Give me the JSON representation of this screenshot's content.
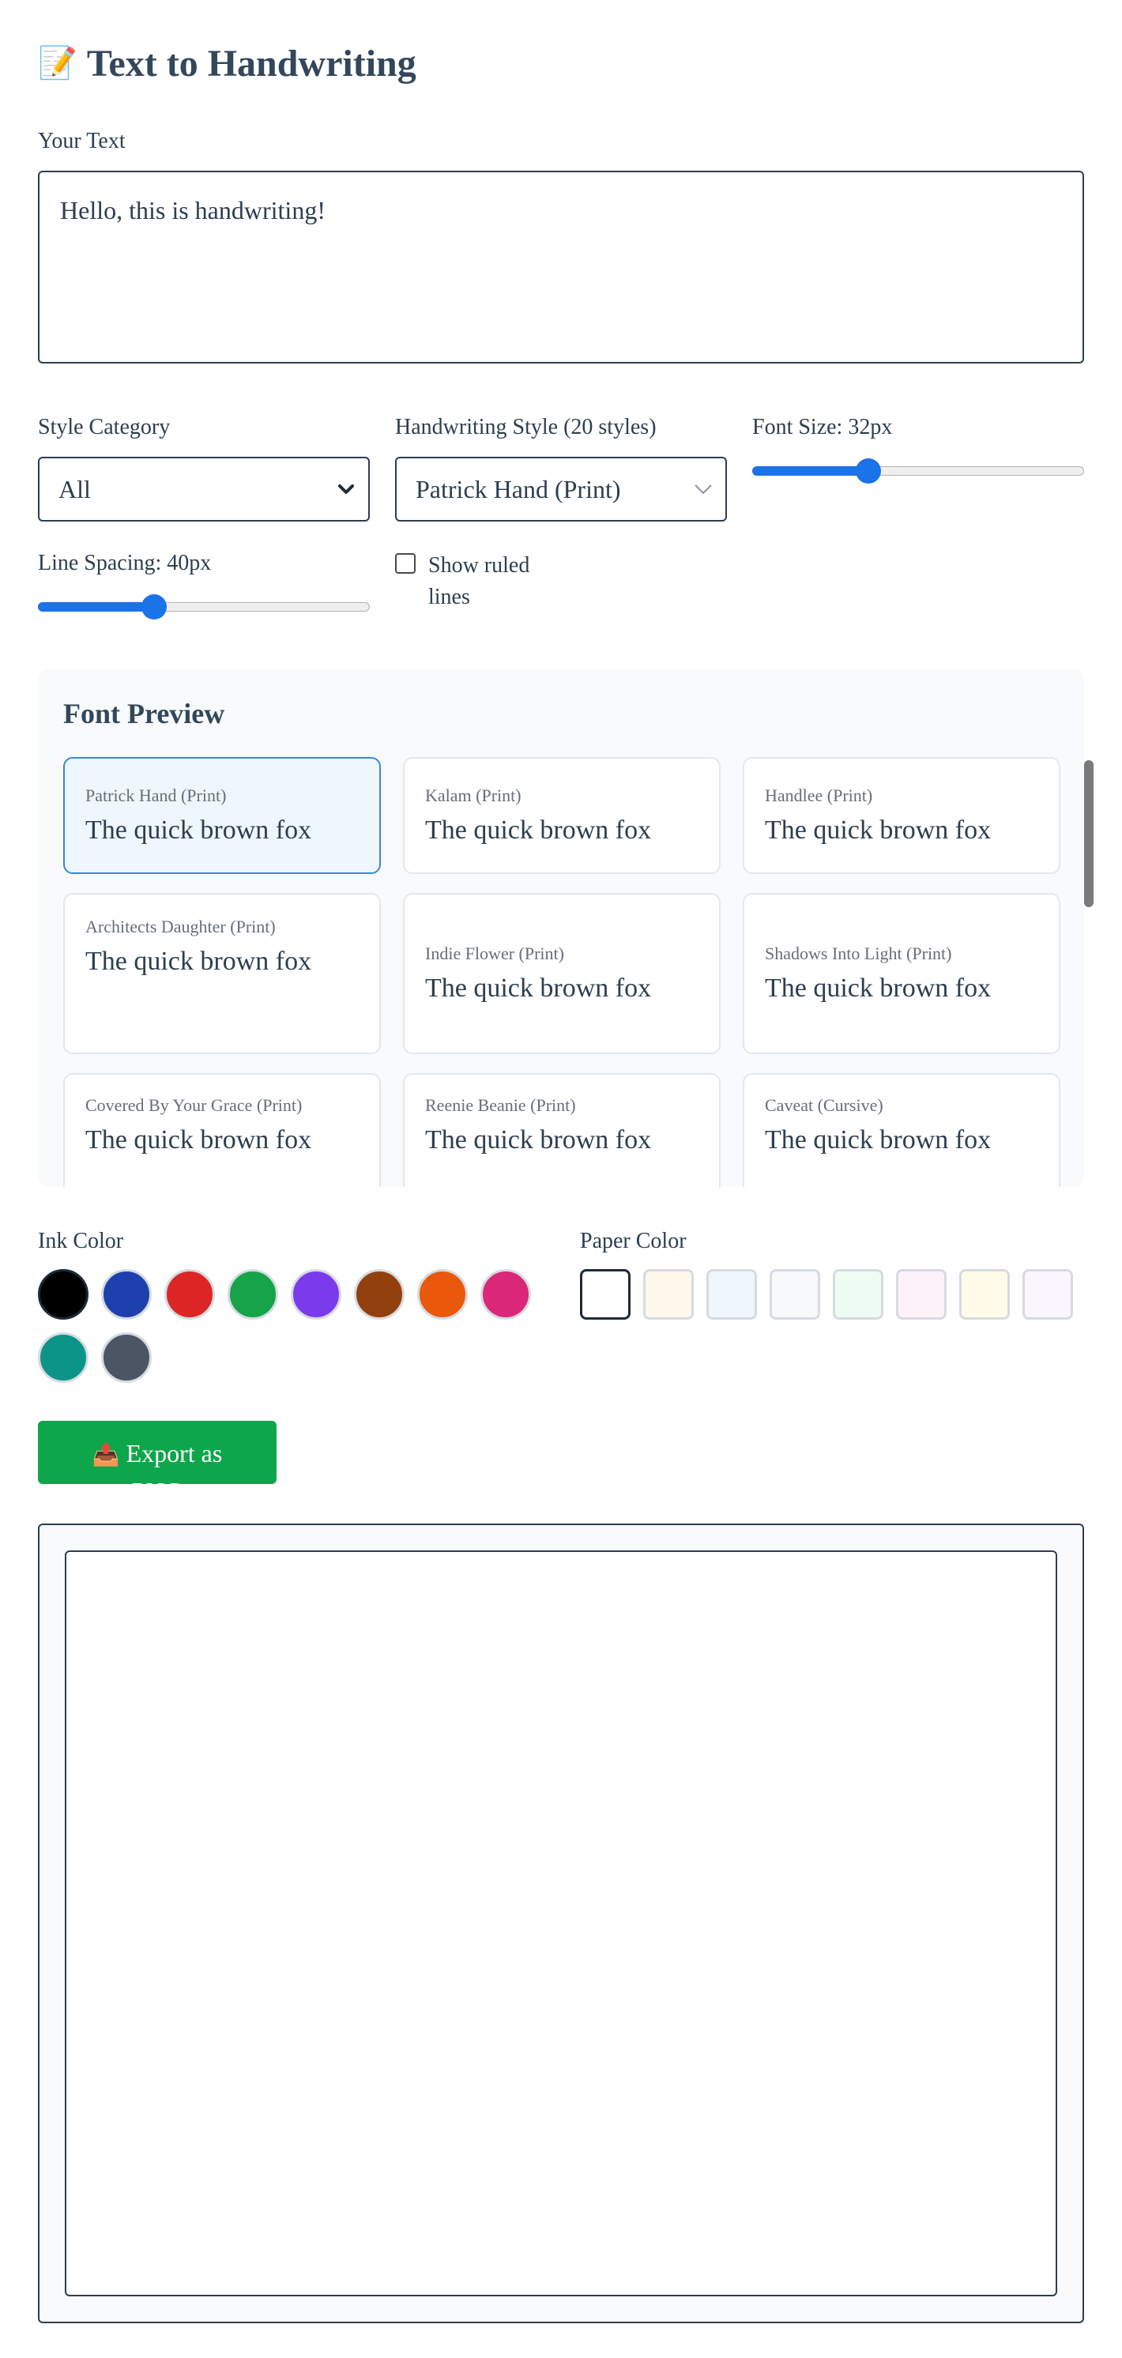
{
  "header": {
    "emoji": "📝",
    "title": "Text to Handwriting"
  },
  "text_input": {
    "label": "Your Text",
    "value": "Hello, this is handwriting!"
  },
  "style_category": {
    "label": "Style Category",
    "selected": "All"
  },
  "handwriting_style": {
    "label": "Handwriting Style (20 styles)",
    "selected": "Patrick Hand (Print)"
  },
  "font_size": {
    "label": "Font Size: 32px",
    "fraction": 0.35
  },
  "line_spacing": {
    "label": "Line Spacing: 40px",
    "fraction": 0.35
  },
  "ruled_lines": {
    "label": "Show ruled lines",
    "checked": false
  },
  "preview": {
    "title": "Font Preview",
    "cards": [
      {
        "name": "Patrick Hand (Print)",
        "sample": "The quick brown fox",
        "selected": true
      },
      {
        "name": "Kalam (Print)",
        "sample": "The quick brown fox"
      },
      {
        "name": "Handlee (Print)",
        "sample": "The quick brown fox"
      },
      {
        "name": "Architects Daughter (Print)",
        "sample": "The quick brown fox"
      },
      {
        "name": "Indie Flower (Print)",
        "sample": "The quick brown fox"
      },
      {
        "name": "Shadows Into Light (Print)",
        "sample": "The quick brown fox"
      },
      {
        "name": "Covered By Your Grace (Print)",
        "sample": "The quick brown fox"
      },
      {
        "name": "Reenie Beanie (Print)",
        "sample": "The quick brown fox"
      },
      {
        "name": "Caveat (Cursive)",
        "sample": "The quick brown fox"
      }
    ]
  },
  "ink_color": {
    "label": "Ink Color",
    "colors": [
      "#000000",
      "#1e40af",
      "#dc2626",
      "#16a34a",
      "#7c3aed",
      "#92400e",
      "#ea580c",
      "#db2777",
      "#0d9488",
      "#4b5563"
    ],
    "selected_index": 0
  },
  "paper_color": {
    "label": "Paper Color",
    "colors": [
      "#ffffff",
      "#fef7ec",
      "#eff6fc",
      "#f8f9fb",
      "#effcf3",
      "#fdf2f8",
      "#fefce8",
      "#faf5ff"
    ],
    "selected_index": 0
  },
  "export": {
    "icon": "📤",
    "label": "Export as PNG"
  }
}
